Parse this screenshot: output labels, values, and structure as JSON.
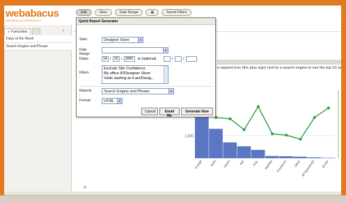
{
  "app": {
    "logo": "webabacus",
    "version": "WEBABACUS VERSION 6.0"
  },
  "sidebar": {
    "tabs": [
      {
        "label": "Favourites"
      }
    ],
    "items": [
      {
        "label": "Days of the Week"
      },
      {
        "label": "Search Engine and Phrase"
      }
    ]
  },
  "toolbar": {
    "buttons": [
      {
        "label": "Edit"
      },
      {
        "label": "Sites"
      },
      {
        "label": "Date Range"
      },
      {
        "label": "▦"
      },
      {
        "label": "Saved Filters"
      }
    ]
  },
  "dialog": {
    "title": "Quick Report Generator",
    "sites_label": "Sites",
    "sites_value": "Designer Store",
    "date_range_label": "Date Range :",
    "date_range_value": "",
    "dates_label": "Dates",
    "date_day": "14",
    "date_month": "10",
    "date_year": "2006",
    "to_label": "to (optional)",
    "filters_label": "Filters :",
    "filters": [
      "Exclude Site Confidence",
      "My office IP/Designer Store",
      "Visits starting at 4 am/Desig..."
    ],
    "reports_label": "Reports :",
    "reports_value": "Search Engine and Phrase",
    "format_label": "Format :",
    "format_value": "HTML",
    "cancel": "Cancel",
    "email": "Email Me",
    "generate": "Generate Now"
  },
  "hint": "e expand icon (the plus sign) next to a search engine to see the top 10 sea",
  "chart_data": {
    "type": "bar",
    "categories": [
      "Google",
      "MSN",
      "Yahoo",
      "Ask",
      "AOL",
      "MyWay",
      "Freeserve",
      "Other",
      "BTOpenworld",
      "Excite"
    ],
    "values": [
      2050,
      1300,
      700,
      530,
      370,
      100,
      90,
      70,
      40,
      20
    ],
    "line": [
      5.1,
      4.5,
      4.4,
      3.6,
      5.3,
      3.3,
      3.2,
      2.9,
      4.5,
      5.2
    ],
    "ytick": "1,000",
    "color": "#5b77c4",
    "line_color": "#2e9c3f"
  },
  "footer": {
    "tab": "⊞"
  }
}
